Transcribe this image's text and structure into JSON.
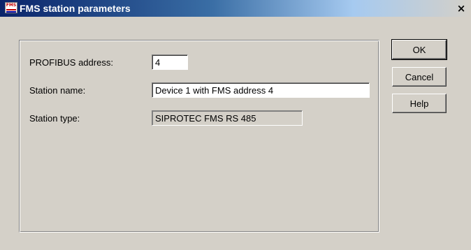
{
  "window": {
    "title": "FMS station parameters",
    "icon": "fms-app-icon",
    "icon_text": "FMS",
    "close_glyph": "×"
  },
  "form": {
    "profibus_address_label": "PROFIBUS address:",
    "profibus_address_value": "4",
    "station_name_label": "Station name:",
    "station_name_value": "Device 1 with FMS address 4",
    "station_type_label": "Station type:",
    "station_type_value": "SIPROTEC FMS RS 485"
  },
  "buttons": {
    "ok": "OK",
    "cancel": "Cancel",
    "help": "Help"
  },
  "colors": {
    "title_gradient_start": "#0a246a",
    "title_gradient_end": "#a6caf0",
    "dialog_face": "#d4d0c8"
  }
}
